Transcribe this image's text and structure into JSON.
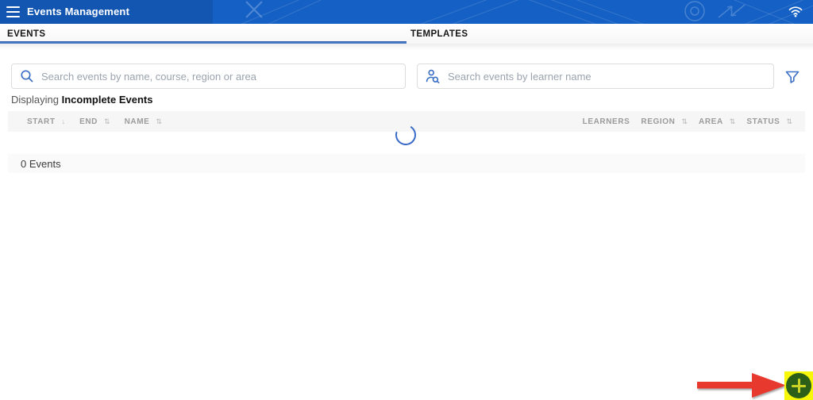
{
  "header": {
    "title": "Events Management"
  },
  "tabs": [
    {
      "label": "EVENTS",
      "active": true
    },
    {
      "label": "TEMPLATES",
      "active": false
    }
  ],
  "search": {
    "events_placeholder": "Search events by name, course, region or area",
    "learner_placeholder": "Search events by learner name"
  },
  "status_line": {
    "prefix": "Displaying",
    "highlight": "Incomplete Events"
  },
  "table": {
    "glyphs": {
      "sort_desc": "↓",
      "sort_both": "⇅"
    },
    "columns": [
      {
        "label": "START",
        "sort": "desc"
      },
      {
        "label": "END",
        "sort": "both"
      },
      {
        "label": "NAME",
        "sort": "both"
      },
      {
        "label": "LEARNERS",
        "sort": "none"
      },
      {
        "label": "REGION",
        "sort": "both"
      },
      {
        "label": "AREA",
        "sort": "both"
      },
      {
        "label": "STATUS",
        "sort": "both"
      }
    ],
    "loading": true,
    "footer_count": "0 Events"
  },
  "colors": {
    "header_blue": "#1560c4",
    "header_blue_dark": "#1256b2",
    "accent_blue": "#3a6fc4",
    "spinner_blue": "#3a6bc9",
    "highlight_yellow": "#f7f70a",
    "fab_green": "#2c5f17",
    "fab_plus_yellow": "#c9d426",
    "arrow_red": "#e8392f"
  }
}
